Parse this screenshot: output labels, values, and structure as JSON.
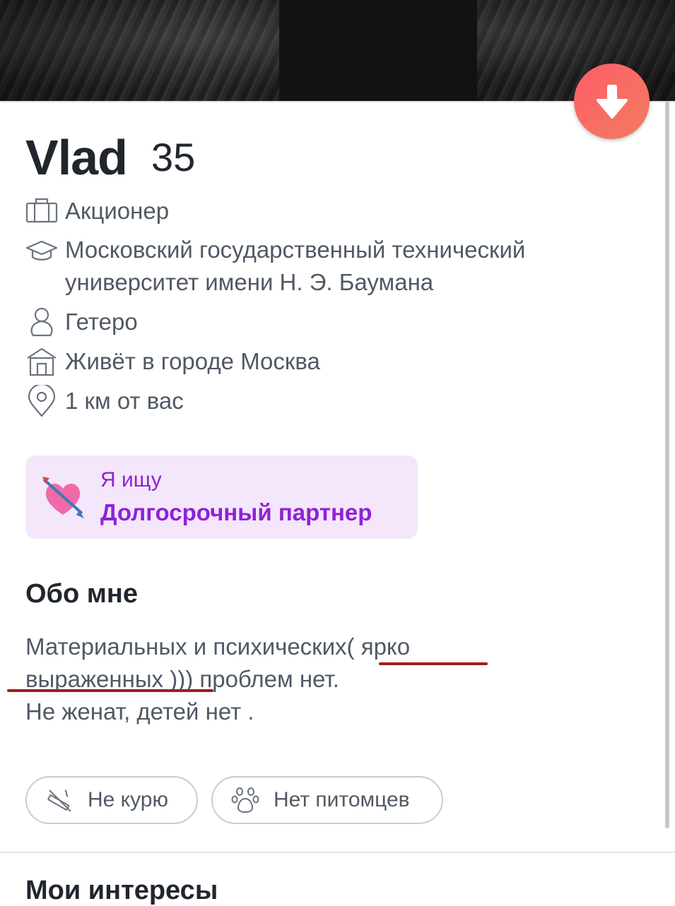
{
  "profile": {
    "name": "Vlad",
    "age": "35"
  },
  "info": {
    "job": "Акционер",
    "school_line1": "Московский государственный технический",
    "school_line2": "университет имени Н. Э. Баумана",
    "orientation": "Гетеро",
    "city": "Живёт в городе Москва",
    "distance": "1 км от вас"
  },
  "looking_for": {
    "label": "Я ищу",
    "value": "Долгосрочный партнер"
  },
  "about": {
    "heading": "Обо мне",
    "line1": "Материальных и психических( ярко",
    "line2": "выраженных )))  проблем нет.",
    "line3": "Не женат, детей нет ."
  },
  "tags": {
    "smoking": "Не курю",
    "pets": "Нет питомцев"
  },
  "sections": {
    "interests_heading": "Мои интересы"
  },
  "colors": {
    "accent_button": "#ff5d6a",
    "looking_for_bg": "#f4e6fb",
    "looking_for_text": "#8e22d6",
    "annotation_underline": "#a11c1c"
  },
  "icons": {
    "down": "arrow-down-icon",
    "job": "briefcase-icon",
    "school": "graduation-cap-icon",
    "orientation": "person-icon",
    "city": "house-icon",
    "distance": "location-pin-icon",
    "looking_for": "heart-arrow-icon",
    "smoking": "no-smoking-icon",
    "pets": "paw-icon"
  }
}
